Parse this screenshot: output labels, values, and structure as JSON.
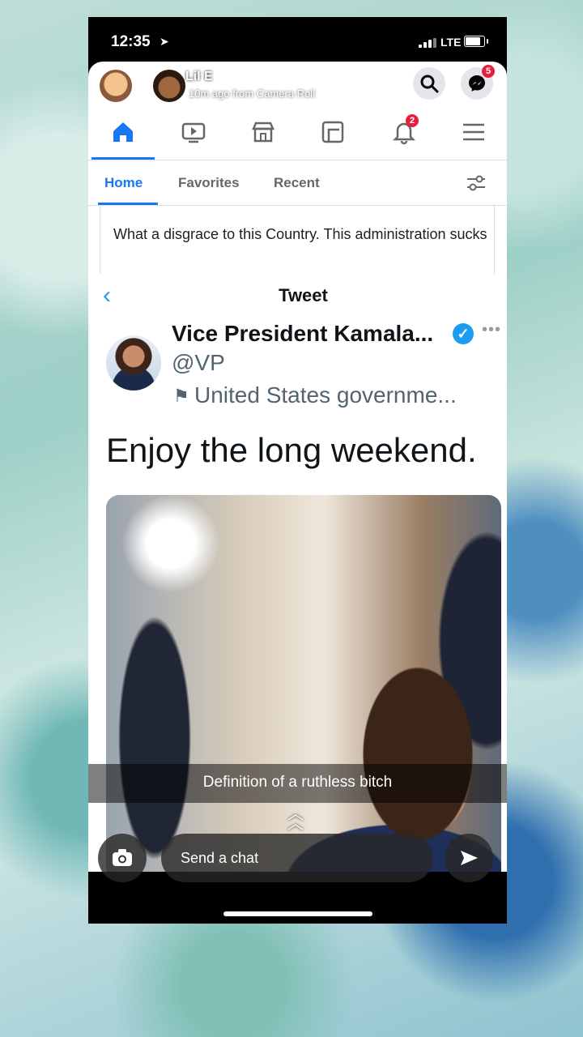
{
  "status_bar": {
    "time": "12:35",
    "network": "LTE"
  },
  "snap_header": {
    "name": "Lil E",
    "subtitle": "10m ago from Camera Roll"
  },
  "fb": {
    "notifications_badge": "2",
    "messenger_badge": "5",
    "accent": "#1877f2",
    "subtabs": [
      "Home",
      "Favorites",
      "Recent"
    ]
  },
  "comment": {
    "text": "What a disgrace to this Country. This administration sucks"
  },
  "tweet_view": {
    "title": "Tweet"
  },
  "tweet": {
    "name": "Vice President Kamala...",
    "handle": "@VP",
    "label": "United States governme...",
    "text": "Enjoy the long weekend."
  },
  "snap_caption": "Definition of a ruthless bitch",
  "chat": {
    "placeholder": "Send a chat"
  }
}
